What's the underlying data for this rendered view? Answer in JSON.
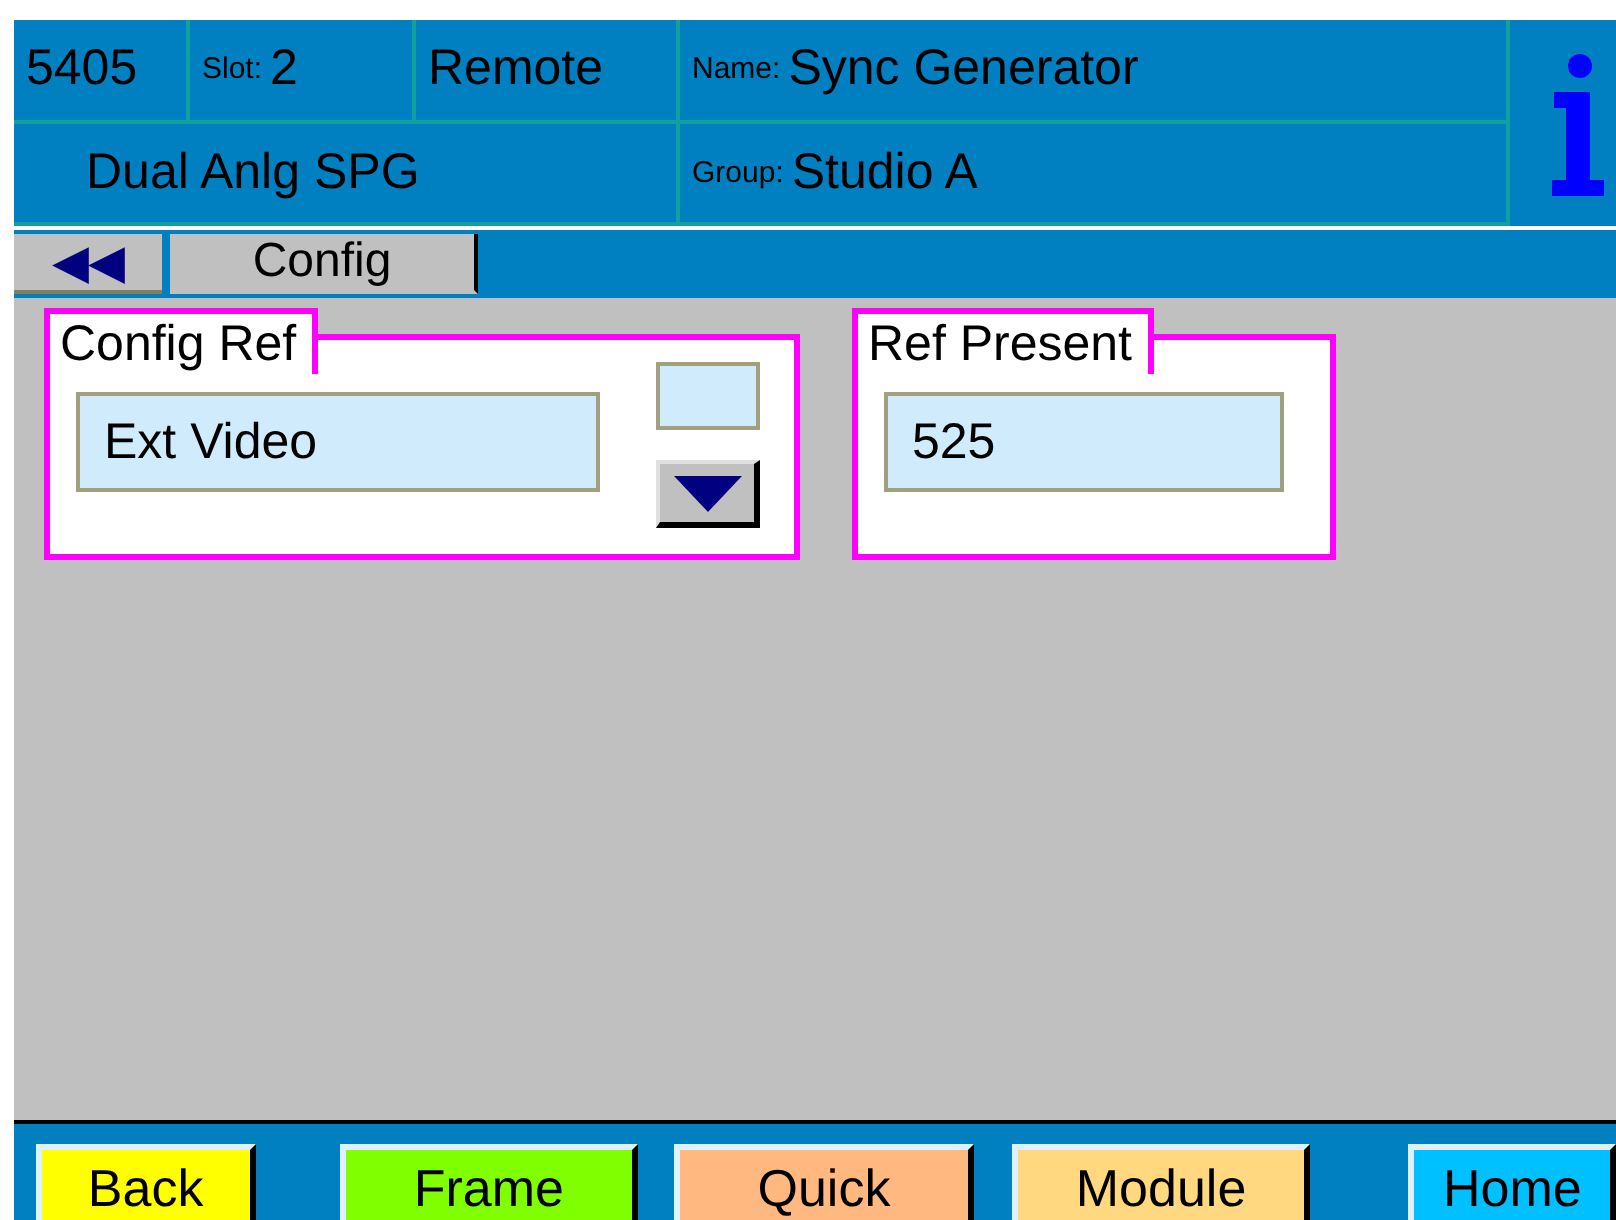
{
  "header": {
    "frame_id": "5405",
    "slot_label": "Slot:",
    "slot": "2",
    "mode": "Remote",
    "name_label": "Name:",
    "name": "Sync Generator",
    "module_type": "Dual Anlg SPG",
    "group_label": "Group:",
    "group": "Studio A"
  },
  "tabs": [
    {
      "label": "◀◀",
      "kind": "back",
      "selected": false
    },
    {
      "label": "Config",
      "kind": "tab",
      "selected": true
    }
  ],
  "panels": [
    {
      "title": "Config Ref",
      "value": "Ext Video",
      "kind": "dropdown"
    },
    {
      "title": "Ref Present",
      "value": "525",
      "kind": "readout"
    }
  ],
  "buttons": [
    {
      "label": "Back",
      "color": "#ffff00"
    },
    {
      "label": "Frame",
      "color": "#80ff00"
    },
    {
      "label": "Quick",
      "color": "#ffb880"
    },
    {
      "label": "Module",
      "color": "#ffd880"
    },
    {
      "label": "Home",
      "color": "#00c0ff"
    }
  ]
}
